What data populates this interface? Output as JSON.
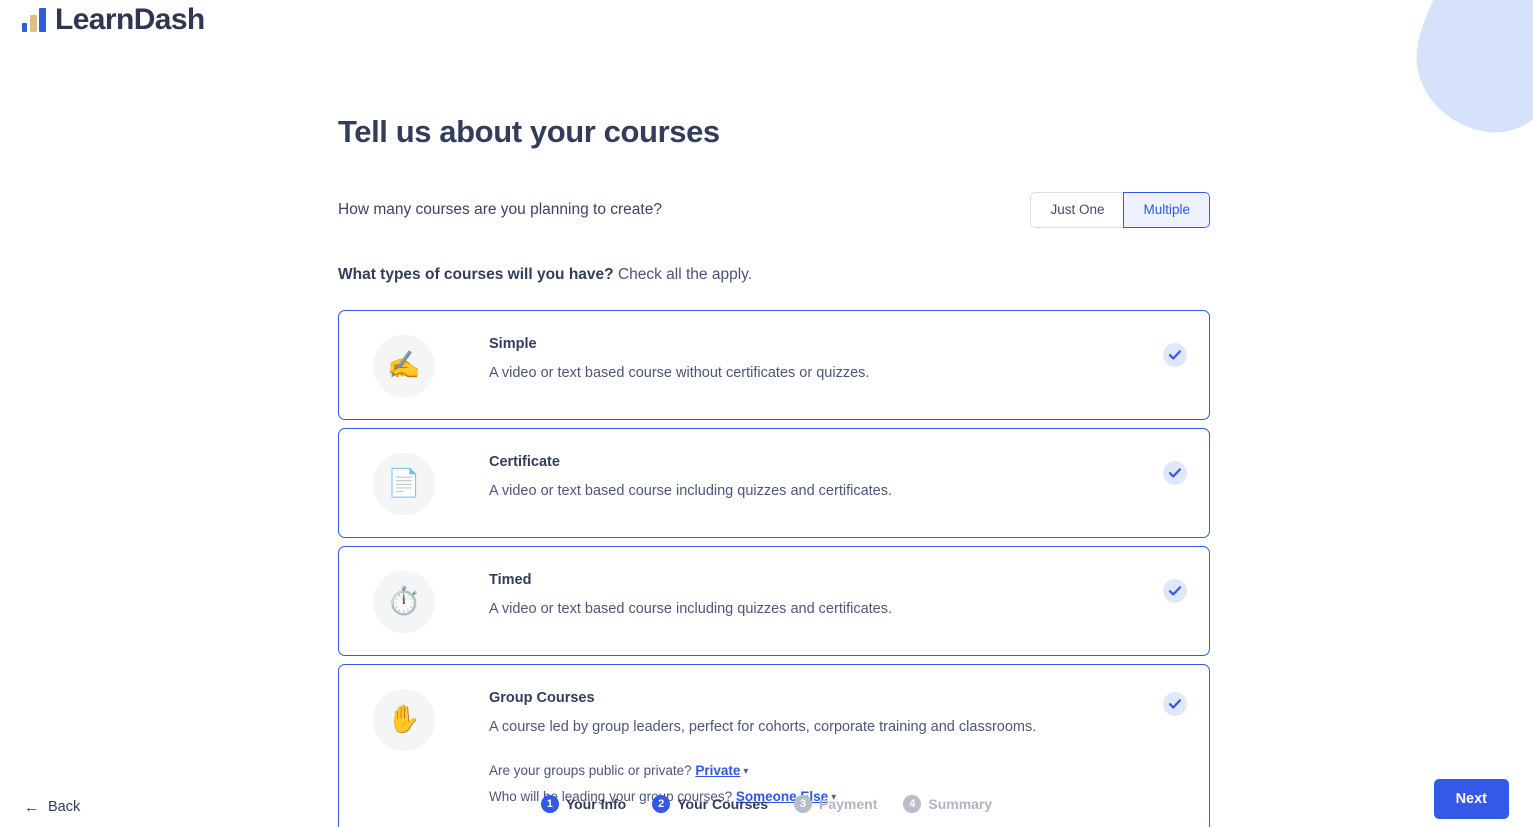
{
  "brand": {
    "name": "LearnDash",
    "logo_icon": "bar-chart-logo-icon",
    "colors": {
      "primary": "#3458e8",
      "accent_gold": "#dcc184",
      "ink": "#343c5c"
    }
  },
  "page": {
    "title": "Tell us about your courses"
  },
  "course_count": {
    "question": "How many courses are you planning to create?",
    "options": [
      {
        "label": "Just One",
        "selected": false
      },
      {
        "label": "Multiple",
        "selected": true
      }
    ]
  },
  "course_types": {
    "question_bold": "What types of courses will you have?",
    "question_rest": "Check all the apply.",
    "cards": [
      {
        "icon": "✍️",
        "icon_name": "writing-hand-icon",
        "title": "Simple",
        "description": "A video or text based course without certificates or quizzes.",
        "selected": true
      },
      {
        "icon": "📄",
        "icon_name": "document-page-icon",
        "title": "Certificate",
        "description": "A video or text based course including quizzes and certificates.",
        "selected": true
      },
      {
        "icon": "⏱️",
        "icon_name": "stopwatch-icon",
        "title": "Timed",
        "description": "A video or text based course including quizzes and certificates.",
        "selected": true
      },
      {
        "icon": "✋",
        "icon_name": "raised-hand-icon",
        "title": "Group Courses",
        "description": "A course led by group leaders, perfect for cohorts, corporate training and classrooms.",
        "selected": true,
        "extras": [
          {
            "prompt": "Are your groups public or private?",
            "value": "Private"
          },
          {
            "prompt": "Who will be leading your group courses?",
            "value": "Someone Else"
          }
        ]
      }
    ]
  },
  "footer": {
    "back_label": "Back",
    "next_label": "Next",
    "steps": [
      {
        "num": "1",
        "label": "Your Info",
        "active": true
      },
      {
        "num": "2",
        "label": "Your Courses",
        "active": true
      },
      {
        "num": "3",
        "label": "Payment",
        "active": false
      },
      {
        "num": "4",
        "label": "Summary",
        "active": false
      }
    ]
  }
}
